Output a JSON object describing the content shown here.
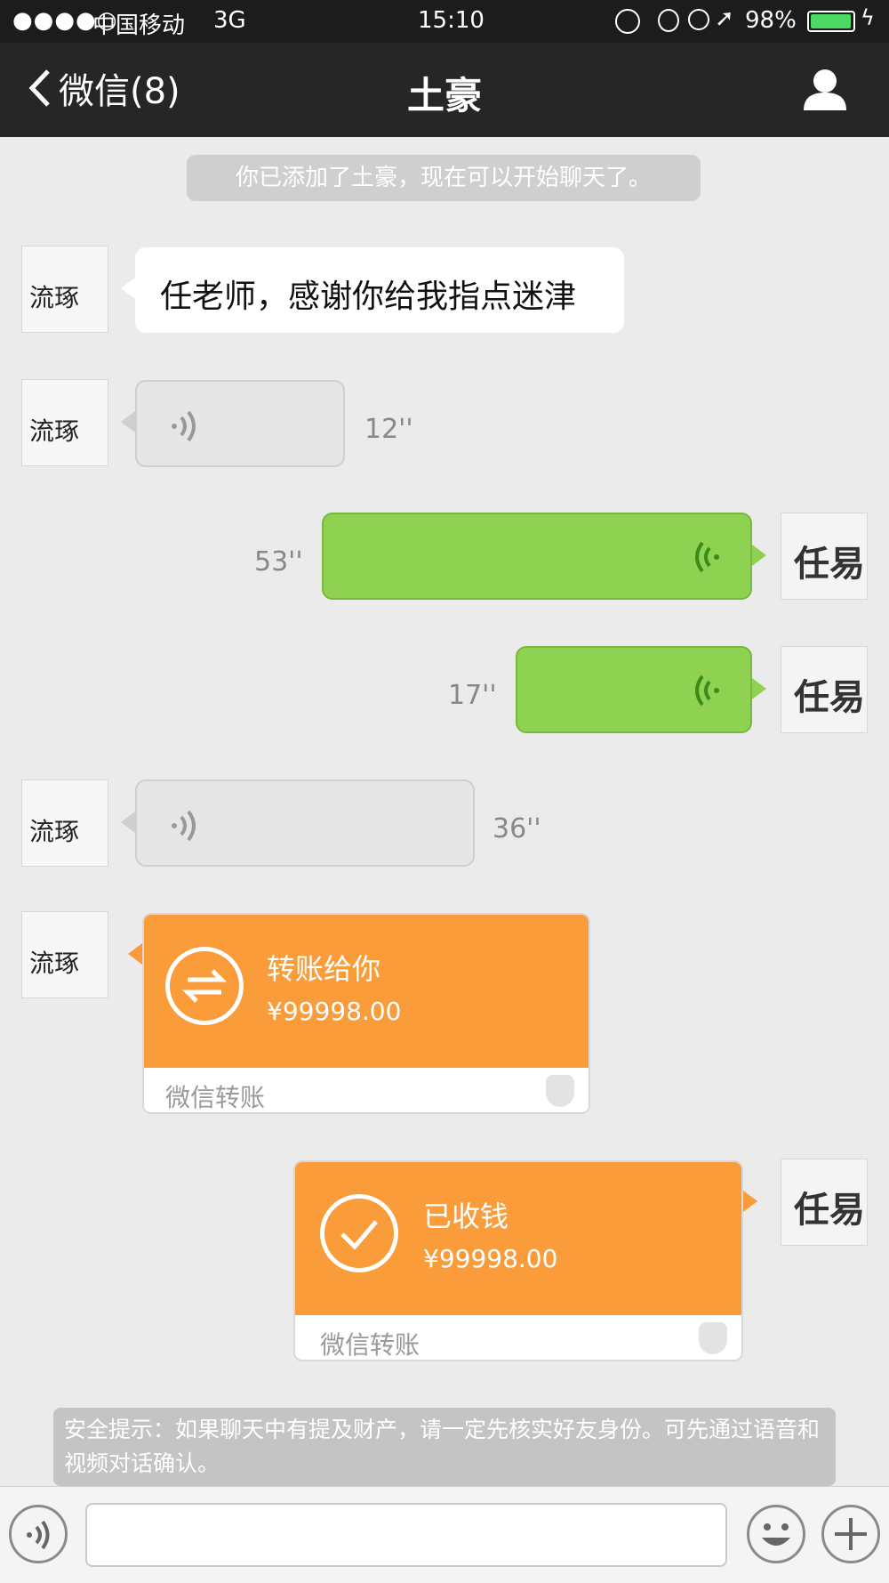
{
  "status_bar": {
    "signal": "●●●●○",
    "carrier": "中国移动",
    "network": "3G",
    "time": "15:10",
    "battery": "98%",
    "battery_level": 0.98
  },
  "nav": {
    "back_label": "微信(8)",
    "title": "土豪",
    "profile_icon": "person-icon"
  },
  "system_notice": "你已添加了土豪，现在可以开始聊天了。",
  "messages": {
    "m1_text": "任老师，感谢你给我指点迷津",
    "m2_duration": "12''",
    "m3_duration": "53''",
    "m4_duration": "17''",
    "m5_duration": "36''",
    "transfer_in": {
      "title": "转账给你",
      "amount": "¥99998.00",
      "footer": "微信转账"
    },
    "transfer_out": {
      "title": "已收钱",
      "amount": "¥99998.00",
      "footer": "微信转账"
    }
  },
  "security_tip": "安全提示：如果聊天中有提及财产，请一定先核实好友身份。可先通过语音和视频对话确认。",
  "avatars": {
    "contact_text": "流琢",
    "me_text": "任易"
  },
  "input": {
    "placeholder": ""
  },
  "colors": {
    "nav_bg": "#262626",
    "chat_bg": "#ebebeb",
    "outgoing_bubble": "#8fd150",
    "transfer_orange": "#f99c39"
  }
}
